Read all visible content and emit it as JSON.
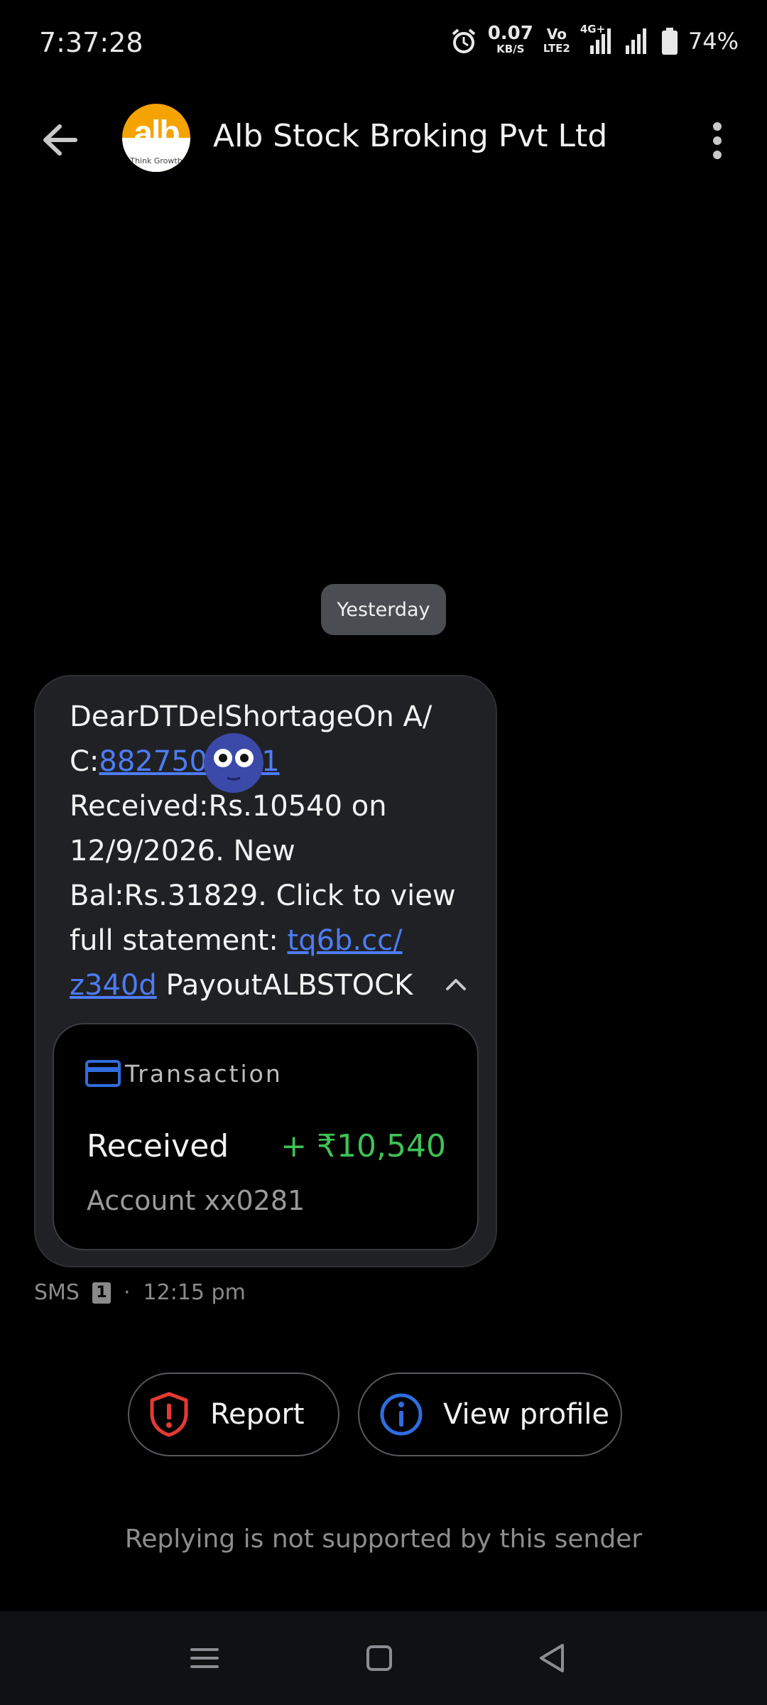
{
  "status_bar": {
    "time": "7:37:28",
    "speed_value": "0.07",
    "speed_unit": "KB/S",
    "volte_top": "Vo",
    "volte_bottom": "LTE2",
    "network": "4G+",
    "battery": "74%"
  },
  "header": {
    "title": "Alb Stock Broking Pvt Ltd",
    "avatar_text": "alb",
    "avatar_tagline": "Think Growth"
  },
  "conversation": {
    "date_chip": "Yesterday",
    "message": {
      "part1": "DearDTDelShortageOn A/ C:",
      "account_link": "882750",
      "account_link_tail": "1",
      "part2": " Received:Rs.10540 on 12/9/2026. New Bal:Rs.31829. Click to view full statement: ",
      "url_link": "tq6b.cc/ z340d",
      "part3": " PayoutALBSTOCK"
    },
    "card": {
      "label": "Transaction",
      "type": "Received",
      "amount": "+ ₹10,540",
      "account": "Account xx0281"
    },
    "meta": {
      "channel": "SMS",
      "sim": "1",
      "separator": "·",
      "time": "12:15 pm"
    }
  },
  "actions": {
    "report_label": "Report",
    "profile_label": "View profile"
  },
  "footer_note": "Replying is not supported by this sender",
  "colors": {
    "link": "#4d7cf5",
    "amount": "#3fc256",
    "report_icon": "#e53935",
    "info_icon": "#2f6de0",
    "avatar_bg": "#f5a300"
  }
}
